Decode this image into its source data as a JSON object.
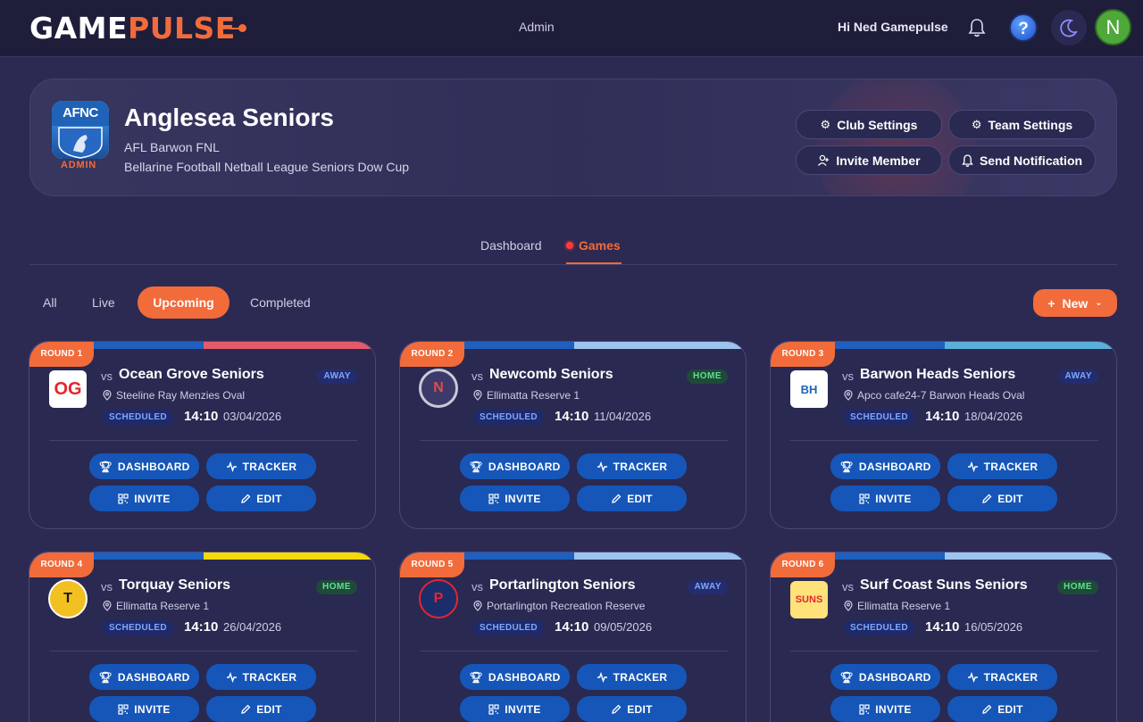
{
  "brand": {
    "logo_part1": "G",
    "logo_part2": "AME",
    "logo_part3": "PULSE"
  },
  "nav": {
    "admin": "Admin",
    "greeting": "Hi Ned Gamepulse",
    "help": "?",
    "avatar_initial": "N"
  },
  "team": {
    "club_logo_text": "AFNC",
    "role": "ADMIN",
    "name": "Anglesea Seniors",
    "league": "AFL Barwon FNL",
    "competition": "Bellarine Football Netball League Seniors Dow Cup",
    "buttons": {
      "club_settings": "Club Settings",
      "team_settings": "Team Settings",
      "invite_member": "Invite Member",
      "send_notification": "Send Notification"
    }
  },
  "tabs": {
    "dashboard": "Dashboard",
    "games": "Games"
  },
  "filters": {
    "all": "All",
    "live": "Live",
    "upcoming": "Upcoming",
    "completed": "Completed",
    "new": "New"
  },
  "card_labels": {
    "vs": "vs",
    "status": "SCHEDULED",
    "dashboard": "DASHBOARD",
    "tracker": "TRACKER",
    "invite": "INVITE",
    "edit": "EDIT"
  },
  "games": [
    {
      "round": "ROUND 1",
      "opponent": "Ocean Grove Seniors",
      "venue": "Steeline Ray Menzies Oval",
      "time": "14:10",
      "date": "03/04/2026",
      "location": "AWAY",
      "logo_text": "OG",
      "color_a": "#1e5fbf",
      "color_b": "#e35b6a"
    },
    {
      "round": "ROUND 2",
      "opponent": "Newcomb Seniors",
      "venue": "Ellimatta Reserve 1",
      "time": "14:10",
      "date": "11/04/2026",
      "location": "HOME",
      "logo_text": "N",
      "color_a": "#1e5fbf",
      "color_b": "#9cc4ee"
    },
    {
      "round": "ROUND 3",
      "opponent": "Barwon Heads Seniors",
      "venue": "Apco cafe24-7 Barwon Heads Oval",
      "time": "14:10",
      "date": "18/04/2026",
      "location": "AWAY",
      "logo_text": "BH",
      "color_a": "#1e5fbf",
      "color_b": "#5ab0d8"
    },
    {
      "round": "ROUND 4",
      "opponent": "Torquay Seniors",
      "venue": "Ellimatta Reserve 1",
      "time": "14:10",
      "date": "26/04/2026",
      "location": "HOME",
      "logo_text": "T",
      "color_a": "#1e5fbf",
      "color_b": "#f5d90a"
    },
    {
      "round": "ROUND 5",
      "opponent": "Portarlington Seniors",
      "venue": "Portarlington Recreation Reserve",
      "time": "14:10",
      "date": "09/05/2026",
      "location": "AWAY",
      "logo_text": "P",
      "color_a": "#1e5fbf",
      "color_b": "#9cc4ee"
    },
    {
      "round": "ROUND 6",
      "opponent": "Surf Coast Suns Seniors",
      "venue": "Ellimatta Reserve 1",
      "time": "14:10",
      "date": "16/05/2026",
      "location": "HOME",
      "logo_text": "SUNS",
      "color_a": "#1e5fbf",
      "color_b": "#9cc4ee"
    }
  ]
}
